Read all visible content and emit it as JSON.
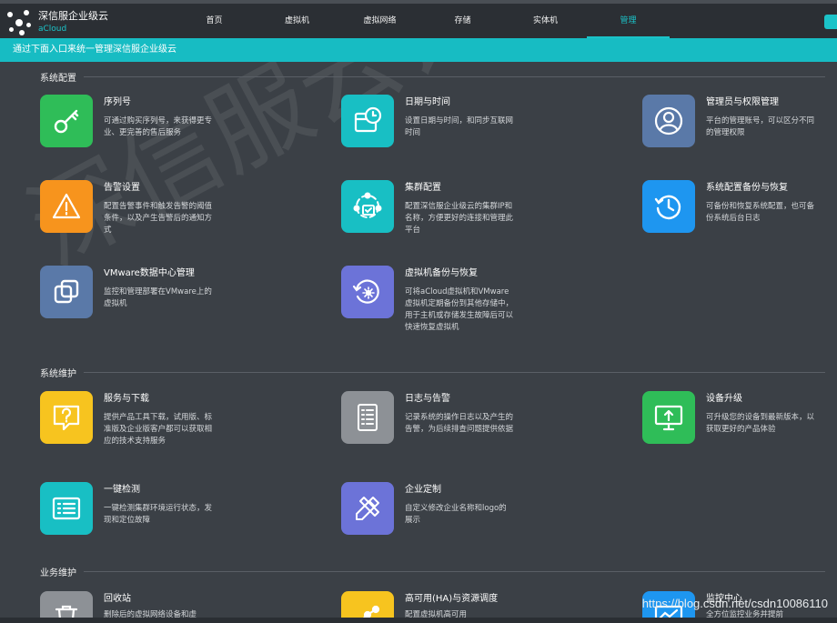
{
  "app": {
    "title": "深信服企业级云",
    "subtitle": "aCloud"
  },
  "nav": {
    "items": [
      "首页",
      "虚拟机",
      "虚拟网络",
      "存储",
      "实体机",
      "管理"
    ],
    "active_index": 5
  },
  "banner": {
    "text": "通过下面入口来统一管理深信服企业级云"
  },
  "sections": {
    "config": {
      "title": "系统配置"
    },
    "maintenance": {
      "title": "系统维护"
    },
    "business": {
      "title": "业务维护"
    }
  },
  "cards": {
    "serial": {
      "title": "序列号",
      "desc": "可通过购买序列号，来获得更专业、更完善的售后服务",
      "color": "#2fbd58",
      "icon": "key-icon"
    },
    "datetime": {
      "title": "日期与时间",
      "desc": "设置日期与时间，和同步互联网时间",
      "color": "#18bfc4",
      "icon": "clock-calendar-icon"
    },
    "admin": {
      "title": "管理员与权限管理",
      "desc": "平台的管理账号，可以区分不同的管理权限",
      "color": "#5a79a8",
      "icon": "user-icon"
    },
    "alarm": {
      "title": "告警设置",
      "desc": "配置告警事件和触发告警的阈值条件，以及产生告警后的通知方式",
      "color": "#f7941d",
      "icon": "warning-icon"
    },
    "cluster": {
      "title": "集群配置",
      "desc": "配置深信服企业级云的集群IP和名称，方便更好的连接和管理此平台",
      "color": "#18bfc4",
      "icon": "cluster-icon"
    },
    "backup": {
      "title": "系统配置备份与恢复",
      "desc": "可备份和恢复系统配置，也可备份系统后台日志",
      "color": "#1e96f0",
      "icon": "restore-icon"
    },
    "vmware": {
      "title": "VMware数据中心管理",
      "desc": "监控和管理部署在VMware上的虚拟机",
      "color": "#5a79a8",
      "icon": "copy-icon"
    },
    "vmbackup": {
      "title": "虚拟机备份与恢复",
      "desc": "可将aCloud虚拟机和VMware虚拟机定期备份到其他存储中，用于主机或存储发生故障后可以快速恢复虚拟机",
      "color": "#6c73d8",
      "icon": "backup-icon"
    },
    "service": {
      "title": "服务与下载",
      "desc": "提供产品工具下载，试用版、标准版及企业版客户都可以获取相应的技术支持服务",
      "color": "#f7c41f",
      "icon": "help-icon"
    },
    "logs": {
      "title": "日志与告警",
      "desc": "记录系统的操作日志以及产生的告警，为后续排查问题提供依据",
      "color": "#8d9196",
      "icon": "document-icon"
    },
    "upgrade": {
      "title": "设备升级",
      "desc": "可升级您的设备到最新版本，以获取更好的产品体验",
      "color": "#2fbd58",
      "icon": "monitor-upload-icon"
    },
    "check": {
      "title": "一键检测",
      "desc": "一键检测集群环境运行状态，发现和定位故障",
      "color": "#18bfc4",
      "icon": "checklist-icon"
    },
    "custom": {
      "title": "企业定制",
      "desc": "自定义修改企业名称和logo的展示",
      "color": "#6c73d8",
      "icon": "design-tools-icon"
    },
    "recycle": {
      "title": "回收站",
      "desc": "删除后的虚拟网络设备和虚",
      "color": "#8d9196",
      "icon": "trash-icon"
    },
    "ha": {
      "title": "高可用(HA)与资源调度",
      "desc": "配置虚拟机高可用",
      "color": "#f7c41f",
      "icon": "ha-icon"
    },
    "monitor": {
      "title": "监控中心",
      "desc": "全方位监控业务并提前",
      "color": "#1e96f0",
      "icon": "monitor-icon"
    }
  },
  "footer": {
    "url": "https://blog.csdn.net/csdn10086110"
  }
}
